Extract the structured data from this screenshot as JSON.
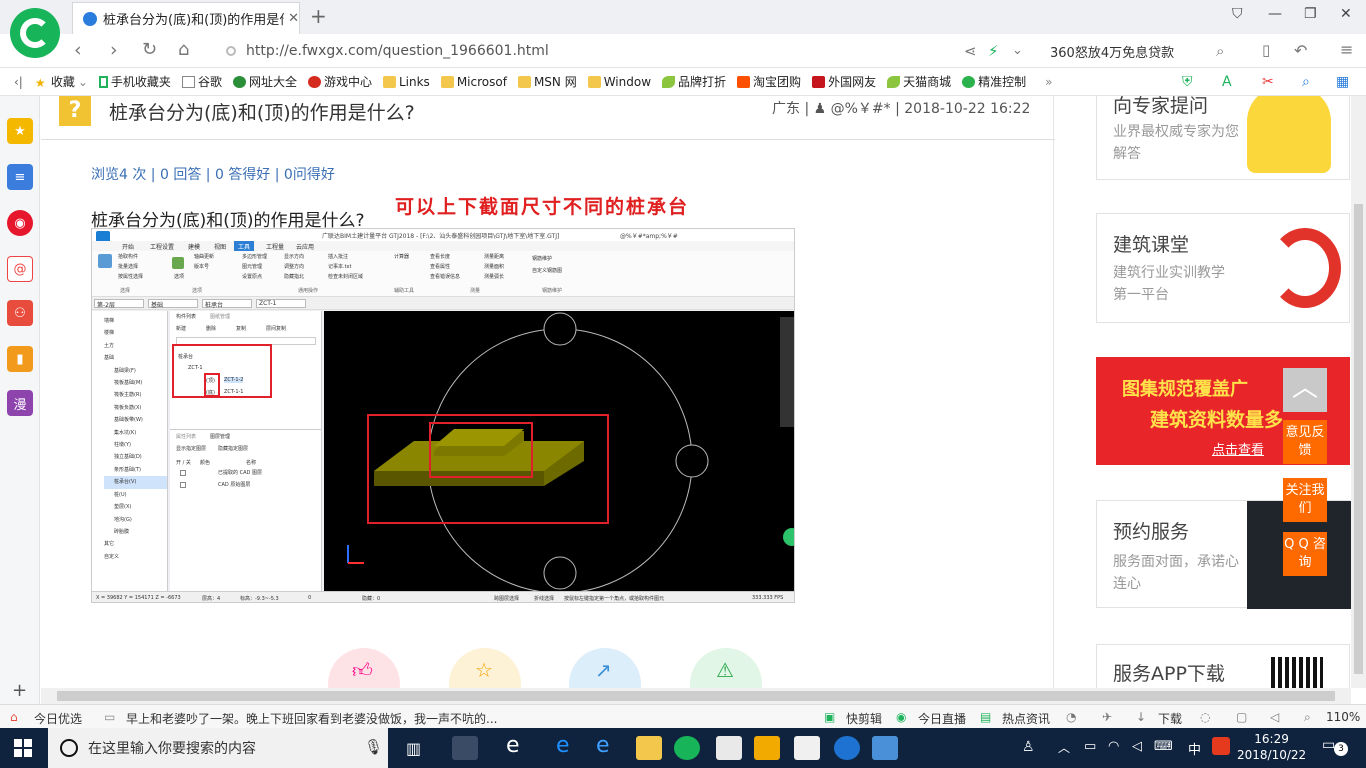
{
  "browser": {
    "tab_title": "桩承台分为(底)和(顶)的作用是什...",
    "url": "http://e.fwxgx.com/question_1966601.html",
    "search_hint": "360怒放4万免息贷款",
    "colors": {
      "logo": "#17b45a",
      "accent": "#ff6a00"
    }
  },
  "bookmarks": [
    {
      "label": "收藏",
      "icon": "star-icon"
    },
    {
      "label": "手机收藏夹",
      "icon": "phone-icon"
    },
    {
      "label": "谷歌",
      "icon": "page-icon"
    },
    {
      "label": "网址大全",
      "icon": "globe-icon"
    },
    {
      "label": "游戏中心",
      "icon": "game-icon"
    },
    {
      "label": "Links",
      "icon": "folder-icon"
    },
    {
      "label": "Microsof",
      "icon": "folder-icon"
    },
    {
      "label": "MSN 网",
      "icon": "folder-icon"
    },
    {
      "label": "Window",
      "icon": "folder-icon"
    },
    {
      "label": "品牌打折",
      "icon": "leaf-icon"
    },
    {
      "label": "淘宝团购",
      "icon": "taobao-icon"
    },
    {
      "label": "外国网友",
      "icon": "flag-icon"
    },
    {
      "label": "天猫商城",
      "icon": "leaf-icon"
    },
    {
      "label": "精准控制",
      "icon": "chat-icon"
    }
  ],
  "question": {
    "title": "桩承台分为(底)和(顶)的作用是什么?",
    "meta": "广东 | ♟ @%￥#* | 2018-10-22 16:22",
    "stats": "浏览4 次 | 0 回答 | 0 答得好 | 0问得好",
    "body": "桩承台分为(底)和(顶)的作用是什么?",
    "annotation": "可以上下截面尺寸不同的桩承台"
  },
  "embedded_screenshot": {
    "window_title": "广联达BIM土建计量平台 GTJ2018 - [F:\\2、汕头泰盛科创园项目\\GTJ\\地下室\\地下室.GTJ]",
    "ribbon_tabs": [
      "开始",
      "工程设置",
      "建模",
      "视图",
      "工具",
      "工程量",
      "云应用"
    ],
    "active_tab": "工具",
    "ribbon_groups": [
      "选择",
      "选项",
      "通用操作",
      "辅助工具",
      "测量",
      "钢筋维护"
    ],
    "ribbon_items": [
      "拾取构件",
      "批量选择",
      "按属性选择",
      "选项",
      "轴曲更新",
      "版本号",
      "多边形管理",
      "图元管理",
      "设置原点",
      "显示方向",
      "调整方向",
      "隐藏指北",
      "插入批注",
      "记事本.txt",
      "检查未封闭区域",
      "计算器",
      "查看长度",
      "查看属性",
      "查看错误信息",
      "测量距离",
      "测量面积",
      "测量弧长",
      "钢筋维护",
      "自定义钢筋图"
    ],
    "dropdowns": [
      "第-2层",
      "基础",
      "桩承台",
      "ZCT-1"
    ],
    "nav_tree": [
      "墙梯",
      "楼梯",
      "土方",
      "基础",
      "基础梁(F)",
      "筏板基础(M)",
      "筏板主筋(R)",
      "筏板负筋(X)",
      "基础板带(W)",
      "集水坑(K)",
      "柱墩(Y)",
      "独立基础(D)",
      "条形基础(T)",
      "桩承台(V)",
      "桩(U)",
      "垫层(X)",
      "地沟(G)",
      "砖胎膜",
      "其它",
      "自定义"
    ],
    "panel_tabs": [
      "构件列表",
      "图纸管理"
    ],
    "panel_buttons": [
      "新建",
      "删除",
      "复制",
      "层间复制"
    ],
    "component_tree": {
      "root": "桩承台",
      "group": "ZCT-1",
      "items": [
        {
          "tag": "(顶)",
          "name": "ZCT-1-2"
        },
        {
          "tag": "(底)",
          "name": "ZCT-1-1"
        }
      ]
    },
    "lower_tabs": [
      "属性列表",
      "图层管理"
    ],
    "lower_buttons": [
      "显示指定图层",
      "隐藏指定图层"
    ],
    "layer_table": {
      "headers": [
        "开 / 关",
        "颜色",
        "名称"
      ],
      "rows": [
        "已提取的 CAD 图层",
        "CAD 原始图层"
      ]
    },
    "status": {
      "coords": "X = 39682 Y = 154171 Z = -6673",
      "floor_height": "层高：4",
      "elevation": "标高：-9.3~-5.3",
      "zero": "0",
      "hidden": "隐藏：0",
      "snap": "跨图层选择",
      "fold": "折线选择",
      "hint": "按鼠标左键指定第一个角点，或拾取构件图元",
      "fps": "333.333 FPS"
    },
    "user": "@%￥#*amp;%￥#"
  },
  "sidebar": {
    "ask": {
      "title": "向专家提问",
      "sub": "业界最权威专家为您解答"
    },
    "course": {
      "title": "建筑课堂",
      "sub": "建筑行业实训教学第一平台"
    },
    "ad": {
      "line1": "图集规范覆盖广",
      "line2": "建筑资料数量多",
      "link": "点击查看"
    },
    "booking": {
      "title": "预约服务",
      "sub": "服务面对面，承诺心连心"
    },
    "app": {
      "title": "服务APP下载"
    }
  },
  "float_buttons": [
    {
      "label": "意见反馈"
    },
    {
      "label": "关注我们"
    },
    {
      "label": "Q Q 咨询"
    }
  ],
  "statusbar": {
    "today": "今日优选",
    "news": "早上和老婆吵了一架。晚上下班回家看到老婆没做饭，我一声不吭的...",
    "items": [
      "快剪辑",
      "今日直播",
      "热点资讯",
      "下载"
    ],
    "zoom": "110%"
  },
  "taskbar": {
    "search_placeholder": "在这里输入你要搜索的内容",
    "ime": "中",
    "time": "16:29",
    "date": "2018/10/22",
    "notifications": "3"
  }
}
